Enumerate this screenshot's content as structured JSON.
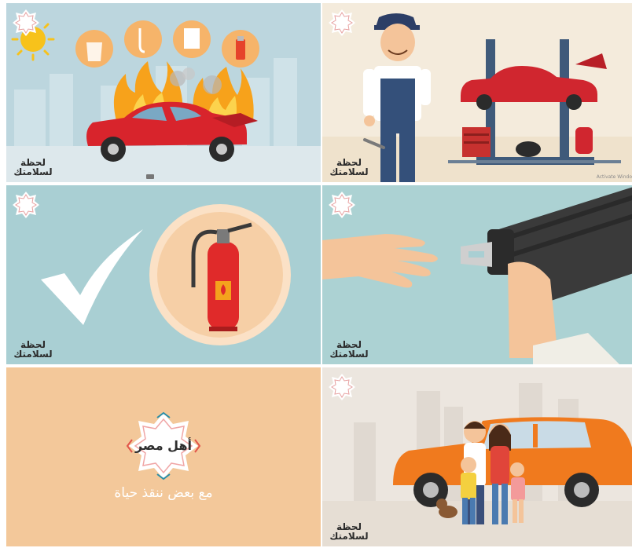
{
  "brand": {
    "badge_text": "أهل مصر",
    "caption_line1": "لحظة",
    "caption_line2": "لسلامتك",
    "tagline": "مع بعض ننقذ حياة"
  },
  "panels": [
    {
      "scene": "car-fire-hazards"
    },
    {
      "scene": "mechanic-car-lift"
    },
    {
      "scene": "fire-extinguisher-check"
    },
    {
      "scene": "seatbelt-hand"
    },
    {
      "scene": "logo-endcard"
    },
    {
      "scene": "family-orange-car"
    }
  ],
  "watermark": {
    "text": "Activate Windo"
  },
  "colors": {
    "sky": "#bcd6de",
    "teal": "#a9cfd3",
    "peach": "#f3c89a",
    "car_red": "#d8242c",
    "car_orange": "#f07a1e",
    "fire_orange": "#f7a21b"
  }
}
